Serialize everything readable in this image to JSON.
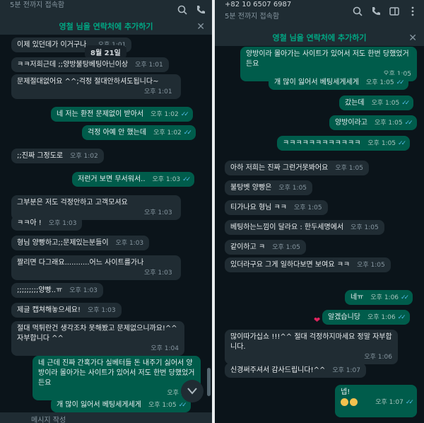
{
  "left": {
    "status": "5분 전까지 접속함",
    "add_contact": "영철 님을 연락처에 추가하기",
    "close": "✕",
    "date_chip": "8월 21일",
    "messages": [
      {
        "text": "이제 있던데가 이거구나..",
        "time": "오후 1:01",
        "dir": "in"
      },
      {
        "text": "ㅋㅋ저희근데 ;;양방불탕베팅아닌이상",
        "time": "오후 1:01",
        "dir": "in"
      },
      {
        "text": "문제절대없어요 ^^;걱정 절대안하셔도됩니다~",
        "time": "오후 1:01",
        "dir": "in"
      },
      {
        "text": "네 저는 환전 문제없이 받아서",
        "time": "오후 1:02",
        "dir": "out"
      },
      {
        "text": "걱정 아예 안 했는데",
        "time": "오후 1:02",
        "dir": "out"
      },
      {
        "text": ";;진짜 그정도로",
        "time": "오후 1:02",
        "dir": "in"
      },
      {
        "text": "저런거 보면 무서워서..",
        "time": "오후 1:03",
        "dir": "out"
      },
      {
        "text": "그부분은 저도 걱정안하고 고객모셔요",
        "time": "오후 1:03",
        "dir": "in"
      },
      {
        "text": "ㅋㅋ아 !",
        "time": "오후 1:03",
        "dir": "in"
      },
      {
        "text": "형님 양빵하고;;문제있는분들이",
        "time": "오후 1:03",
        "dir": "in"
      },
      {
        "text": "짤리면 다그래요...........어느 사이트를가나",
        "time": "오후 1:03",
        "dir": "in"
      },
      {
        "text": ";;;;;;;;;양빵..ㅠ",
        "time": "오후 1:03",
        "dir": "in"
      },
      {
        "text": "제글 캡쳐해놓으세요!",
        "time": "오후 1:03",
        "dir": "in"
      },
      {
        "text": "절대 먹튀란건 생각조차 못해봤고 문제없으니까요!^^ 자부합니다 ^^",
        "time": "오후 1:04",
        "dir": "in"
      },
      {
        "text": "네 근데 진짜 간혹가다 실베터들 돈 내주기 싫어서 양방이라 몰아가는 사이트가 있어서 저도 한번 당했었거든요",
        "time": "오후 1:05",
        "dir": "out"
      },
      {
        "text": "개 많이 잃어서 베팅세게세게",
        "time": "오후 1:05",
        "dir": "out"
      }
    ],
    "input_placeholder": "메시지 작성"
  },
  "right": {
    "phone": "+82 10 6507 6987",
    "status": "5분 전까지 접속함",
    "add_contact": "영철 님을 연락처에 추가하기",
    "close": "✕",
    "messages": [
      {
        "text": "양방이라 몰아가는 사이트가 있어서 저도 한번 당했었거든요",
        "time": "오후 1:05",
        "dir": "out"
      },
      {
        "text": "개 많이 잃어서 베팅세게세게",
        "time": "오후 1:05",
        "dir": "out"
      },
      {
        "text": "갔는데",
        "time": "오후 1:05",
        "dir": "out"
      },
      {
        "text": "양방이라고",
        "time": "오후 1:05",
        "dir": "out"
      },
      {
        "text": "ㅋㅋㅋㅋㅋㅋㅋㅋㅋㅋㅋㅋ",
        "time": "오후 1:05",
        "dir": "out"
      },
      {
        "text": "아하 저희는 진짜 그런거못봐어요",
        "time": "오후 1:05",
        "dir": "in"
      },
      {
        "text": "불탕벳 양빵은",
        "time": "오후 1:05",
        "dir": "in"
      },
      {
        "text": "티가나요 형님 ㅋㅋ",
        "time": "오후 1:05",
        "dir": "in"
      },
      {
        "text": "베팅하는느낌이 달라요 : 한두세명에서",
        "time": "오후 1:05",
        "dir": "in"
      },
      {
        "text": "같이하고 ㅋ",
        "time": "오후 1:05",
        "dir": "in"
      },
      {
        "text": "있더라구요 그게 일하다보면 보여요 ㅋㅋ",
        "time": "오후 1:05",
        "dir": "in"
      },
      {
        "text": "네ㅠ",
        "time": "오후 1:06",
        "dir": "out"
      },
      {
        "text": "알겠습니당",
        "time": "오후 1:06",
        "dir": "out"
      },
      {
        "text": "많이따가십쇼 !!!^^ 절대 걱정하지마세요 정말 자부합니다.",
        "time": "오후 1:06",
        "dir": "in"
      },
      {
        "text": "신경써주셔서 감사드립니다!^^",
        "time": "오후 1:07",
        "dir": "in"
      },
      {
        "text": "넵!",
        "time": "오후 1:07",
        "dir": "out"
      }
    ]
  },
  "colors": {
    "incoming": "#202c33",
    "outgoing": "#005c4b",
    "accent": "#00a884",
    "read_tick": "#53bdeb"
  }
}
